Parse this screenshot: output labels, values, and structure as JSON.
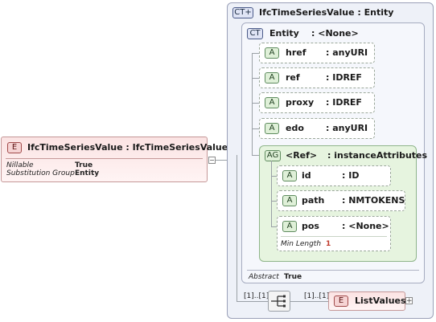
{
  "left_element": {
    "badge": "E",
    "title": "IfcTimeSeriesValue : IfcTimeSeriesValue",
    "props": [
      {
        "key": "Nillable",
        "value": "True"
      },
      {
        "key": "Substitution Group",
        "value": "Entity"
      }
    ]
  },
  "complex_type": {
    "badge": "CT+",
    "title": "IfcTimeSeriesValue : Entity"
  },
  "entity_type": {
    "badge": "CT",
    "name": "Entity",
    "type": ": <None>",
    "abstract_label": "Abstract",
    "abstract_value": "True"
  },
  "attributes": [
    {
      "badge": "A",
      "name": "href",
      "type": ": anyURI"
    },
    {
      "badge": "A",
      "name": "ref",
      "type": ": IDREF"
    },
    {
      "badge": "A",
      "name": "proxy",
      "type": ": IDREF"
    },
    {
      "badge": "A",
      "name": "edo",
      "type": ": anyURI"
    }
  ],
  "attribute_group": {
    "badge": "AG",
    "name": "<Ref>",
    "type": ": instanceAttributes",
    "attributes": [
      {
        "badge": "A",
        "name": "id",
        "type": ": ID"
      },
      {
        "badge": "A",
        "name": "path",
        "type": ": NMTOKENS"
      },
      {
        "badge": "A",
        "name": "pos",
        "type": ": <None>",
        "facet_label": "Min Length",
        "facet_value": "1"
      }
    ]
  },
  "sequence": {
    "occurs_left": "[1]..[1]",
    "occurs_right": "[1]..[1]"
  },
  "list_values": {
    "badge": "E",
    "name": "ListValues"
  },
  "colors": {
    "element_fill": "#fde8e8",
    "ct_fill": "#edf0fa",
    "attr_fill": "#eef7ea",
    "border": "#9aa0a6"
  }
}
